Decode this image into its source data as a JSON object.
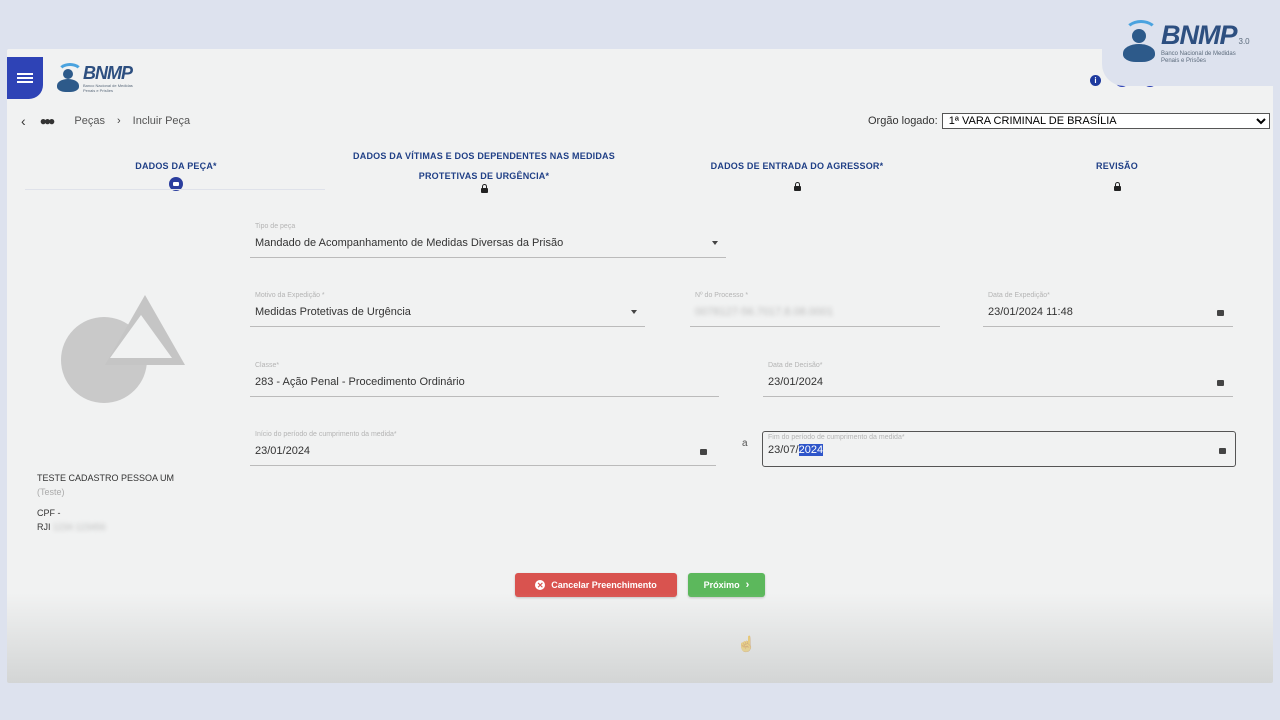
{
  "brand": {
    "name": "BNMP",
    "version": "3.0",
    "subtitle": "Banco Nacional de Medidas Penais e Prisões"
  },
  "header": {
    "menu_icon": "hamburger-icon",
    "icons": [
      "info-icon",
      "settings-icon",
      "search-icon"
    ]
  },
  "breadcrumb": {
    "back_icon": "chevron-left-icon",
    "people_icon": "people-icon",
    "items": [
      "Peças",
      "Incluir Peça"
    ]
  },
  "orgao": {
    "label": "Orgão logado:",
    "selected": "1ª VARA CRIMINAL DE BRASÍLIA"
  },
  "steps": [
    {
      "label": "DADOS DA PEÇA*",
      "active": true
    },
    {
      "label_line1": "DADOS DA VÍTIMAS E DOS DEPENDENTES NAS MEDIDAS",
      "label_line2": "PROTETIVAS DE URGÊNCIA*",
      "active": false
    },
    {
      "label": "DADOS DE ENTRADA DO AGRESSOR*",
      "active": false
    },
    {
      "label": "REVISÃO",
      "active": false
    }
  ],
  "form": {
    "tipo_peca": {
      "label": "Tipo de peça",
      "value": "Mandado de Acompanhamento de Medidas Diversas da Prisão"
    },
    "motivo": {
      "label": "Motivo da Expedição *",
      "value": "Medidas Protetivas de Urgência"
    },
    "processo": {
      "label": "Nº do Processo *",
      "value": "0078127-56.7017.8.08.0001"
    },
    "data_expedicao": {
      "label": "Data de Expedição*",
      "value": "23/01/2024 11:48"
    },
    "classe": {
      "label": "Classe*",
      "value": "283 - Ação Penal - Procedimento Ordinário"
    },
    "data_decisao": {
      "label": "Data de Decisão*",
      "value": "23/01/2024"
    },
    "inicio": {
      "label": "Início do período de cumprimento da medida*",
      "value": "23/01/2024"
    },
    "separator": "a",
    "fim": {
      "label": "Fim do período de cumprimento da medida*",
      "value_prefix": "23/07/",
      "value_selected": "2024"
    }
  },
  "person": {
    "name": "TESTE CADASTRO PESSOA UM",
    "role": "(Teste)",
    "cpf": "CPF -",
    "rji_label": "RJI",
    "rji_value": "1234 123456"
  },
  "buttons": {
    "cancel": "Cancelar Preenchimento",
    "next": "Próximo"
  },
  "colors": {
    "primary": "#2e43b6",
    "step_text": "#1f3f86",
    "cancel": "#d9534f",
    "next": "#5cb85c"
  }
}
